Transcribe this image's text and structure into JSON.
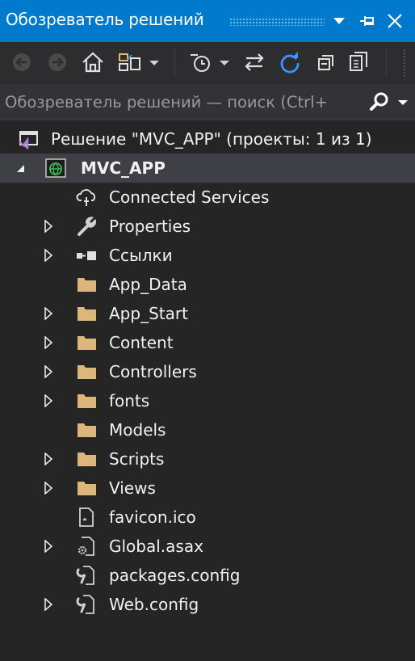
{
  "window": {
    "title": "Обозреватель решений",
    "buttons": [
      "chevron-down-icon",
      "pin-icon",
      "close-icon"
    ]
  },
  "toolbar": {
    "buttons": [
      "back-icon",
      "forward-icon",
      "home-icon",
      "switch-views-icon",
      "history-icon",
      "sync-icon",
      "refresh-icon",
      "collapse-all-icon",
      "show-all-files-icon"
    ]
  },
  "search": {
    "placeholder": "Обозреватель решений — поиск (Ctrl+"
  },
  "tree": {
    "solution": "Решение \"MVC_APP\" (проекты: 1 из 1)",
    "project": "MVC_APP",
    "items": [
      {
        "label": "Connected Services",
        "icon": "cloud-icon",
        "expandable": false
      },
      {
        "label": "Properties",
        "icon": "wrench-icon",
        "expandable": true
      },
      {
        "label": "Ссылки",
        "icon": "references-icon",
        "expandable": true
      },
      {
        "label": "App_Data",
        "icon": "folder-icon",
        "expandable": false
      },
      {
        "label": "App_Start",
        "icon": "folder-icon",
        "expandable": true
      },
      {
        "label": "Content",
        "icon": "folder-icon",
        "expandable": true
      },
      {
        "label": "Controllers",
        "icon": "folder-icon",
        "expandable": true
      },
      {
        "label": "fonts",
        "icon": "folder-icon",
        "expandable": true
      },
      {
        "label": "Models",
        "icon": "folder-icon",
        "expandable": false
      },
      {
        "label": "Scripts",
        "icon": "folder-icon",
        "expandable": true
      },
      {
        "label": "Views",
        "icon": "folder-icon",
        "expandable": true
      },
      {
        "label": "favicon.ico",
        "icon": "image-file-icon",
        "expandable": false
      },
      {
        "label": "Global.asax",
        "icon": "settings-file-icon",
        "expandable": true
      },
      {
        "label": "packages.config",
        "icon": "config-file-icon",
        "expandable": false
      },
      {
        "label": "Web.config",
        "icon": "config-file-icon",
        "expandable": true
      }
    ]
  },
  "colors": {
    "title_bar": "#007acc",
    "background": "#252526",
    "toolbar": "#2d2d30",
    "search": "#333337",
    "selected_row": "#3f3f46",
    "folder": "#dcb67a",
    "refresh": "#3794ff"
  }
}
